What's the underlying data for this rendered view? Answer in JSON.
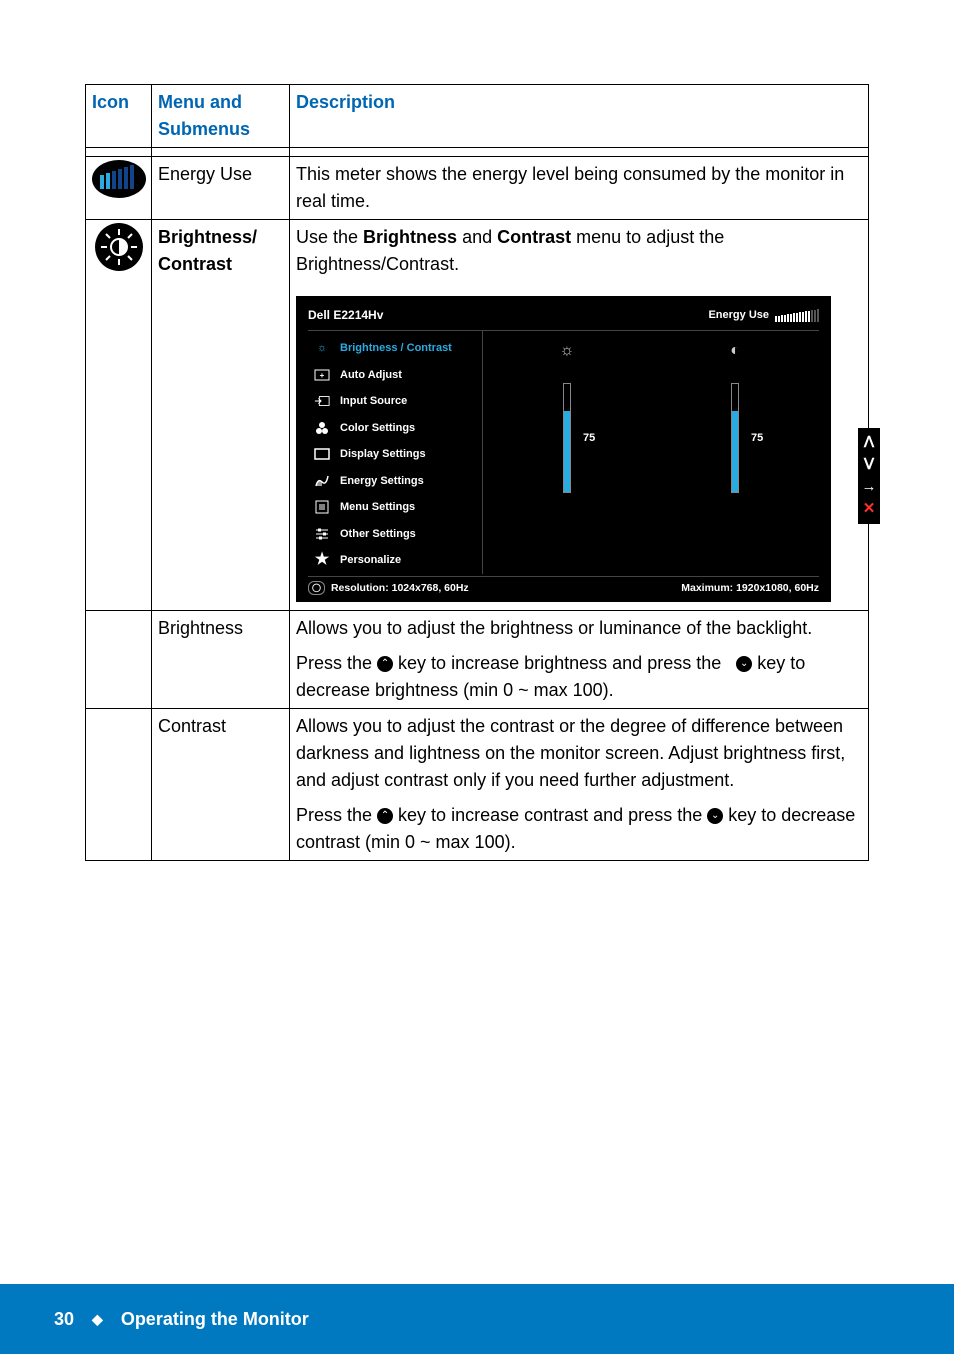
{
  "table": {
    "headers": {
      "icon": "Icon",
      "menu": "Menu and Submenus",
      "desc": "Description"
    },
    "rows": {
      "energy_use": {
        "menu": "Energy Use",
        "desc": "This meter shows the energy level being consumed by the monitor in real time."
      },
      "brightness_contrast": {
        "menu1": "Brightness/",
        "menu2": "Contrast",
        "desc_pre": "Use the ",
        "desc_b1": "Brightness",
        "desc_mid": " and ",
        "desc_b2": "Contrast",
        "desc_post": " menu to adjust the Brightness/Contrast."
      },
      "brightness": {
        "menu": "Brightness",
        "p1": "Allows you to adjust the brightness or luminance of the backlight.",
        "p2a": "Press the ",
        "p2b": " key to increase brightness and press the ",
        "p2c": " key to decrease brightness (min 0 ~ max 100)."
      },
      "contrast": {
        "menu": "Contrast",
        "p1": "Allows you to adjust the contrast or the degree of difference between darkness and lightness on the monitor screen. Adjust brightness first, and adjust contrast only if you need further adjustment.",
        "p2a": "Press the ",
        "p2b": " key to increase contrast and press the ",
        "p2c": " key to decrease contrast (min 0 ~ max 100)."
      }
    }
  },
  "osd": {
    "model": "Dell E2214Hv",
    "energy_label": "Energy Use",
    "menu_items": [
      "Brightness / Contrast",
      "Auto Adjust",
      "Input Source",
      "Color Settings",
      "Display Settings",
      "Energy Settings",
      "Menu Settings",
      "Other Settings",
      "Personalize"
    ],
    "brightness_value": "75",
    "contrast_value": "75",
    "footer_res": "Resolution: 1024x768,  60Hz",
    "footer_max": "Maximum: 1920x1080,  60Hz"
  },
  "footer": {
    "page_num": "30",
    "section": "Operating the Monitor"
  },
  "key_up": "⌃",
  "key_down": "⌄"
}
